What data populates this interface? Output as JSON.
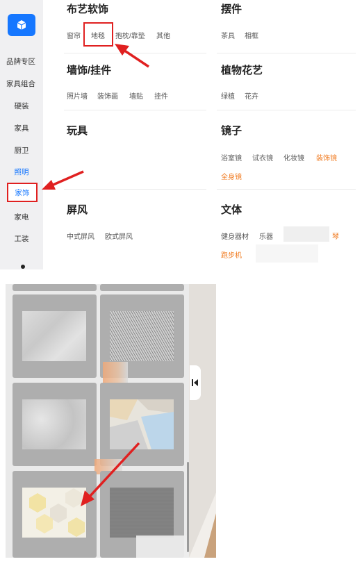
{
  "sidebar": {
    "items": [
      {
        "label": "品牌专区"
      },
      {
        "label": "家具组合"
      },
      {
        "label": "硬装"
      },
      {
        "label": "家具"
      },
      {
        "label": "厨卫"
      },
      {
        "label": "照明"
      },
      {
        "label": "家饰"
      },
      {
        "label": "家电"
      },
      {
        "label": "工装"
      }
    ],
    "active_label": "照明",
    "selected_label": "家饰"
  },
  "categories": {
    "fabric": {
      "title": "布艺软饰",
      "subs": [
        "窗帘",
        "地毯",
        "抱枕/靠垫",
        "其他"
      ]
    },
    "ornament": {
      "title": "摆件",
      "subs": [
        "茶具",
        "相框"
      ]
    },
    "wall": {
      "title": "墙饰/挂件",
      "subs": [
        "照片墙",
        "装饰画",
        "墙贴",
        "挂件"
      ]
    },
    "plant": {
      "title": "植物花艺",
      "subs": [
        "绿植",
        "花卉"
      ]
    },
    "toy": {
      "title": "玩具",
      "subs": []
    },
    "mirror": {
      "title": "镜子",
      "subs": [
        "浴室镜",
        "试衣镜",
        "化妆镜",
        "装饰镜",
        "全身镜"
      ]
    },
    "screen": {
      "title": "屏风",
      "subs": [
        "中式屏风",
        "欧式屏风"
      ]
    },
    "sports": {
      "title": "文体",
      "subs": [
        "健身器材",
        "乐器",
        "琴",
        "跑步机"
      ]
    }
  },
  "colors": {
    "accent": "#1677ff",
    "highlight": "#f07a1f",
    "annotation": "#e02020",
    "sidebar_bg": "#f0f0f2"
  },
  "icons": {
    "logo": "cube-icon",
    "collapse": "collapse-left-icon"
  }
}
